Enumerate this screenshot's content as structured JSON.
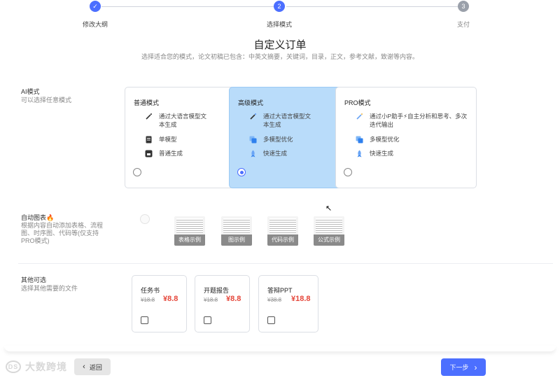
{
  "steps": [
    {
      "label": "修改大纲",
      "marker": "✓",
      "state": "done"
    },
    {
      "label": "选择模式",
      "marker": "2",
      "state": "active"
    },
    {
      "label": "支付",
      "marker": "3",
      "state": "todo"
    }
  ],
  "page": {
    "title": "自定义订单",
    "subtitle": "选择适合您的模式，论文初稿已包含：中英文摘要，关键词，目录，正文，参考文献，致谢等内容。"
  },
  "ai_mode": {
    "title": "AI模式",
    "desc": "可以选择任意模式",
    "cards": [
      {
        "title": "普通模式",
        "selected": false,
        "features": [
          {
            "icon": "magic-wand-icon",
            "text": "通过大语言模型文本生成"
          },
          {
            "icon": "document-icon",
            "text": "单模型"
          },
          {
            "icon": "archive-icon",
            "text": "普通生成"
          }
        ]
      },
      {
        "title": "高级模式",
        "selected": true,
        "features": [
          {
            "icon": "magic-wand-icon",
            "text": "通过大语言模型文本生成"
          },
          {
            "icon": "layers-icon",
            "text": "多模型优化"
          },
          {
            "icon": "rocket-icon",
            "text": "快速生成"
          }
        ]
      },
      {
        "title": "PRO模式",
        "selected": false,
        "features": [
          {
            "icon": "magic-wand-icon",
            "text": "通过小P助手⚡自主分析和思考、多次迭代输出"
          },
          {
            "icon": "layers-icon",
            "text": "多模型优化"
          },
          {
            "icon": "rocket-icon",
            "text": "快速生成"
          }
        ]
      }
    ]
  },
  "auto_chart": {
    "title": "自动图表🔥",
    "desc": "根据内容自动添加表格、流程图、时序图、代码等(仅支持PRO模式)",
    "examples": [
      "表格示例",
      "图示例",
      "代码示例",
      "公式示例"
    ]
  },
  "extras": {
    "title": "其他可选",
    "desc": "选择其他需要的文件",
    "items": [
      {
        "name": "任务书",
        "old_price": "¥18.8",
        "price": "¥8.8"
      },
      {
        "name": "开题报告",
        "old_price": "¥18.8",
        "price": "¥8.8"
      },
      {
        "name": "答辩PPT",
        "old_price": "¥38.8",
        "price": "¥18.8"
      }
    ]
  },
  "footer": {
    "logo": "大数跨境",
    "back": "返回",
    "next": "下一步"
  },
  "colors": {
    "accent": "#4c6fff",
    "selected_bg": "#b9dcfa",
    "price": "#e5463a"
  }
}
